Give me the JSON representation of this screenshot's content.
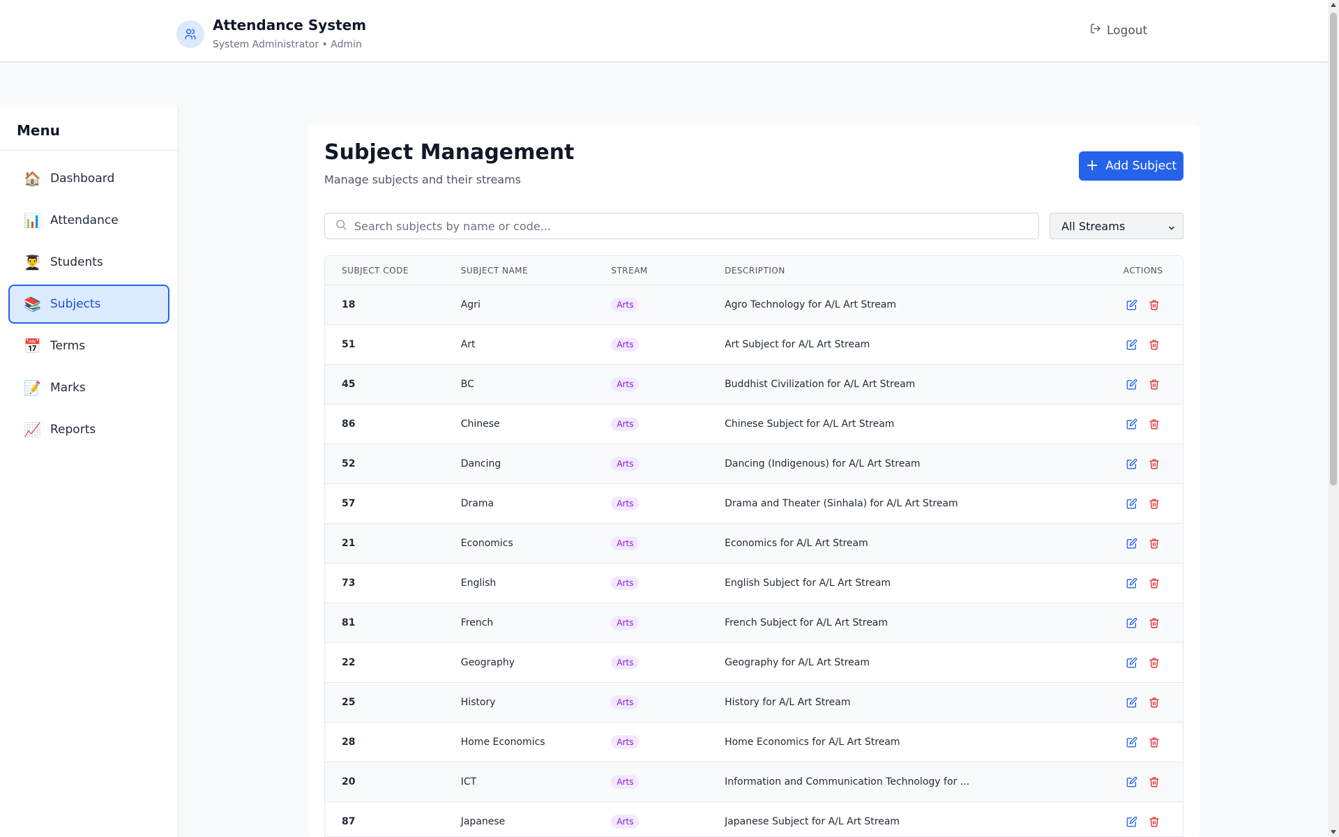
{
  "header": {
    "app_title": "Attendance System",
    "user_info": "System Administrator • Admin",
    "logout_label": "Logout"
  },
  "sidebar": {
    "title": "Menu",
    "items": [
      {
        "label": "Dashboard",
        "icon": "🏠",
        "name": "house-icon"
      },
      {
        "label": "Attendance",
        "icon": "📊",
        "name": "bar-chart-icon"
      },
      {
        "label": "Students",
        "icon": "👨‍🎓",
        "name": "student-icon"
      },
      {
        "label": "Subjects",
        "icon": "📚",
        "name": "books-icon",
        "active": true
      },
      {
        "label": "Terms",
        "icon": "📅",
        "name": "calendar-icon"
      },
      {
        "label": "Marks",
        "icon": "📝",
        "name": "memo-icon"
      },
      {
        "label": "Reports",
        "icon": "📈",
        "name": "trend-chart-icon"
      }
    ]
  },
  "main": {
    "title": "Subject Management",
    "subtitle": "Manage subjects and their streams",
    "add_button_label": "Add Subject",
    "search_placeholder": "Search subjects by name or code...",
    "stream_filter_value": "All Streams",
    "columns": [
      "SUBJECT CODE",
      "SUBJECT NAME",
      "STREAM",
      "DESCRIPTION",
      "ACTIONS"
    ],
    "rows": [
      {
        "code": "18",
        "name": "Agri",
        "stream": "Arts",
        "description": "Agro Technology for A/L Art Stream"
      },
      {
        "code": "51",
        "name": "Art",
        "stream": "Arts",
        "description": "Art Subject for A/L Art Stream"
      },
      {
        "code": "45",
        "name": "BC",
        "stream": "Arts",
        "description": "Buddhist Civilization for A/L Art Stream"
      },
      {
        "code": "86",
        "name": "Chinese",
        "stream": "Arts",
        "description": "Chinese Subject for A/L Art Stream"
      },
      {
        "code": "52",
        "name": "Dancing",
        "stream": "Arts",
        "description": "Dancing (Indigenous) for A/L Art Stream"
      },
      {
        "code": "57",
        "name": "Drama",
        "stream": "Arts",
        "description": "Drama and Theater (Sinhala) for A/L Art Stream"
      },
      {
        "code": "21",
        "name": "Economics",
        "stream": "Arts",
        "description": "Economics for A/L Art Stream"
      },
      {
        "code": "73",
        "name": "English",
        "stream": "Arts",
        "description": "English Subject for A/L Art Stream"
      },
      {
        "code": "81",
        "name": "French",
        "stream": "Arts",
        "description": "French Subject for A/L Art Stream"
      },
      {
        "code": "22",
        "name": "Geography",
        "stream": "Arts",
        "description": "Geography for A/L Art Stream"
      },
      {
        "code": "25",
        "name": "History",
        "stream": "Arts",
        "description": "History for A/L Art Stream"
      },
      {
        "code": "28",
        "name": "Home Economics",
        "stream": "Arts",
        "description": "Home Economics for A/L Art Stream"
      },
      {
        "code": "20",
        "name": "ICT",
        "stream": "Arts",
        "description": "Information and Communication Technology for ..."
      },
      {
        "code": "87",
        "name": "Japanese",
        "stream": "Arts",
        "description": "Japanese Subject for A/L Art Stream"
      }
    ]
  },
  "colors": {
    "primary": "#2563eb",
    "badge_bg": "#f3e8ff",
    "badge_text": "#7e22ce",
    "delete": "#dc2626"
  }
}
